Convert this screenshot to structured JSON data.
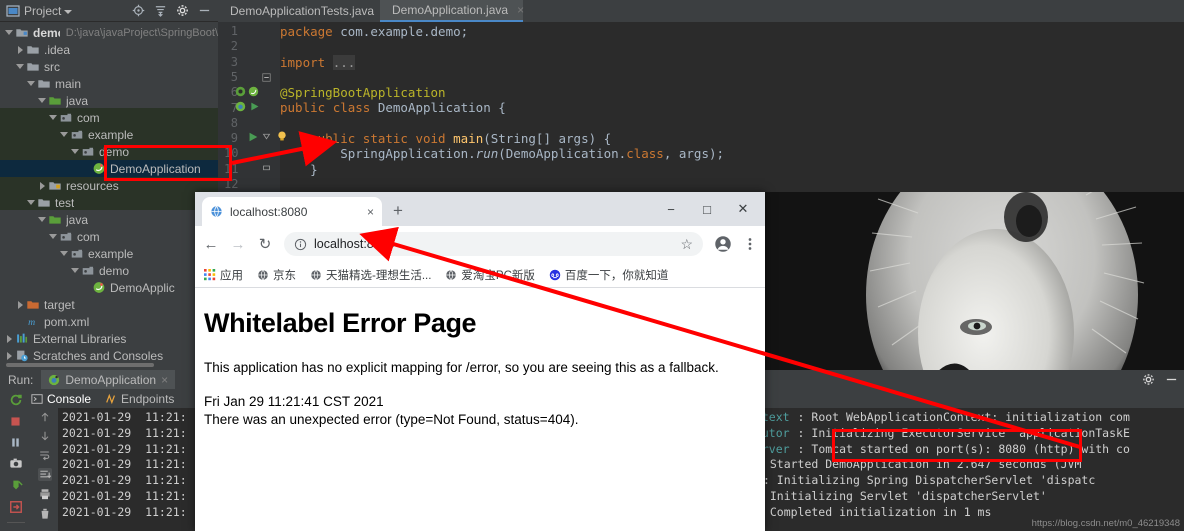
{
  "ide": {
    "project_panel": {
      "title": "Project",
      "icons": [
        "project-icon",
        "locate-icon",
        "collapse-all-icon",
        "settings-icon",
        "hide-icon"
      ],
      "tree": [
        {
          "label": "demo",
          "path": "D:\\java\\javaProject\\SpringBoot\\",
          "icon": "module-icon",
          "depth": 0,
          "state": "expanded",
          "bold": true
        },
        {
          "label": ".idea",
          "path": "",
          "icon": "folder-icon",
          "depth": 1,
          "state": "collapsed",
          "bold": false
        },
        {
          "label": "src",
          "path": "",
          "icon": "folder-icon",
          "depth": 1,
          "state": "expanded",
          "bold": false
        },
        {
          "label": "main",
          "path": "",
          "icon": "folder-icon",
          "depth": 2,
          "state": "expanded",
          "bold": false
        },
        {
          "label": "java",
          "path": "",
          "icon": "source-root-icon",
          "depth": 3,
          "state": "expanded",
          "bold": false
        },
        {
          "label": "com",
          "path": "",
          "icon": "package-icon",
          "depth": 4,
          "state": "expanded",
          "bold": false
        },
        {
          "label": "example",
          "path": "",
          "icon": "package-icon",
          "depth": 5,
          "state": "expanded",
          "bold": false
        },
        {
          "label": "demo",
          "path": "",
          "icon": "package-icon",
          "depth": 6,
          "state": "expanded",
          "bold": false
        },
        {
          "label": "DemoApplication",
          "path": "",
          "icon": "spring-class-icon",
          "depth": 7,
          "state": "leaf",
          "bold": false
        },
        {
          "label": "resources",
          "path": "",
          "icon": "resource-root-icon",
          "depth": 3,
          "state": "collapsed",
          "bold": false
        },
        {
          "label": "test",
          "path": "",
          "icon": "folder-icon",
          "depth": 2,
          "state": "expanded",
          "bold": false
        },
        {
          "label": "java",
          "path": "",
          "icon": "test-source-root-icon",
          "depth": 3,
          "state": "expanded",
          "bold": false
        },
        {
          "label": "com",
          "path": "",
          "icon": "package-icon",
          "depth": 4,
          "state": "expanded",
          "bold": false
        },
        {
          "label": "example",
          "path": "",
          "icon": "package-icon",
          "depth": 5,
          "state": "expanded",
          "bold": false
        },
        {
          "label": "demo",
          "path": "",
          "icon": "package-icon",
          "depth": 6,
          "state": "expanded",
          "bold": false
        },
        {
          "label": "DemoApplic",
          "path": "",
          "icon": "spring-class-icon",
          "depth": 7,
          "state": "leaf",
          "bold": false
        },
        {
          "label": "target",
          "path": "",
          "icon": "excluded-folder-icon",
          "depth": 1,
          "state": "collapsed",
          "bold": false
        },
        {
          "label": "pom.xml",
          "path": "",
          "icon": "maven-icon",
          "depth": 1,
          "state": "leaf",
          "bold": false
        },
        {
          "label": "External Libraries",
          "path": "",
          "icon": "libraries-icon",
          "depth": 0,
          "state": "collapsed",
          "bold": false
        },
        {
          "label": "Scratches and Consoles",
          "path": "",
          "icon": "scratches-icon",
          "depth": 0,
          "state": "collapsed",
          "bold": false
        }
      ]
    },
    "editor": {
      "tabs": [
        {
          "label": "DemoApplicationTests.java",
          "icon": "spring-class-icon",
          "active": false,
          "close": "×"
        },
        {
          "label": "DemoApplication.java",
          "icon": "spring-boot-class-icon",
          "active": true,
          "close": "×"
        }
      ],
      "line_numbers": [
        "1",
        "2",
        "3",
        "5",
        "6",
        "7",
        "8",
        "9",
        "10",
        "11",
        "12"
      ],
      "lines": [
        "package com.example.demo;",
        "",
        "import ...",
        "",
        "@SpringBootApplication",
        "public class DemoApplication {",
        "",
        "    public static void main(String[] args) {",
        "        SpringApplication.run(DemoApplication.class, args);",
        "    }"
      ],
      "gutter_icons": [
        "spring-bean-icon",
        "spring-config-icon",
        "spring-boot-icon",
        "run-gutter-icon",
        "run-method-icon",
        "intention-bulb-icon"
      ]
    },
    "run_window": {
      "label": "Run:",
      "config_name": "DemoApplication",
      "config_close": "×",
      "sub_tabs": [
        {
          "label": "Console",
          "icon": "console-icon",
          "active": true
        },
        {
          "label": "Endpoints",
          "icon": "endpoints-icon",
          "active": false
        }
      ],
      "left_toolbar": [
        "rerun-icon",
        "stop-icon",
        "pause-icon",
        "camera-icon",
        "thread-dump-icon",
        "exit-icon"
      ],
      "console_gutter": [
        "scroll-up-icon",
        "scroll-down-icon",
        "soft-wrap-icon",
        "scroll-to-end-icon",
        "print-icon",
        "clear-all-icon"
      ],
      "header_right": [
        "settings-gear-icon",
        "hide-icon"
      ],
      "timestamps": [
        "2021-01-29  11:21:",
        "2021-01-29  11:21:",
        "2021-01-29  11:21:",
        "2021-01-29  11:21:",
        "2021-01-29  11:21:",
        "2021-01-29  11:21:",
        "2021-01-29  11:21:"
      ],
      "log_lines": [
        {
          "tag": "ontext",
          "text": ": Root WebApplicationContext: initialization com"
        },
        {
          "tag": "ecutor",
          "text": ": Initializing ExecutorService 'applicationTaskE"
        },
        {
          "tag": "Server",
          "text": ": Tomcat started on port(s): 8080 (http) with co"
        },
        {
          "tag": "",
          "text": ": Started DemoApplication in 2.647 seconds (JVM"
        },
        {
          "tag": "]",
          "text": ": Initializing Spring DispatcherServlet 'dispatc"
        },
        {
          "tag": "",
          "text": ": Initializing Servlet 'dispatcherServlet'"
        },
        {
          "tag": "",
          "text": ": Completed initialization in 1 ms"
        }
      ]
    }
  },
  "browser": {
    "tab": {
      "title": "localhost:8080",
      "favicon": "globe-icon",
      "close": "×"
    },
    "new_tab": "+",
    "window_buttons": {
      "minimize": "−",
      "maximize": "□",
      "close": "✕"
    },
    "nav": {
      "back": "←",
      "forward": "→",
      "reload": "↻"
    },
    "omnibox": {
      "info_icon": "info-circle-icon",
      "url": "localhost:8080",
      "star": "☆"
    },
    "profile_icon": "profile-avatar-icon",
    "menu_icon": "three-dot-menu-icon",
    "bookmarks": [
      {
        "label": "应用",
        "icon": "apps-grid-icon"
      },
      {
        "label": "京东",
        "icon": "globe-icon"
      },
      {
        "label": "天猫精选-理想生活...",
        "icon": "globe-icon"
      },
      {
        "label": "爱淘宝PC新版",
        "icon": "globe-icon"
      },
      {
        "label": "百度一下，你就知道",
        "icon": "baidu-icon"
      }
    ],
    "page": {
      "title": "Whitelabel Error Page",
      "paragraph": "This application has no explicit mapping for /error, so you are seeing this as a fallback.",
      "timestamp": "Fri Jan 29 11:21:41 CST 2021",
      "error": "There was an unexpected error (type=Not Found, status=404)."
    }
  },
  "annotations": {
    "highlight_color": "#ff0000",
    "boxes": [
      "project-demoapplication-highlight",
      "tomcat-port-highlight"
    ],
    "arrows": [
      "tree-to-main-method-arrow",
      "tomcat-log-to-url-arrow"
    ]
  },
  "watermark": "https://blog.csdn.net/m0_46219348"
}
